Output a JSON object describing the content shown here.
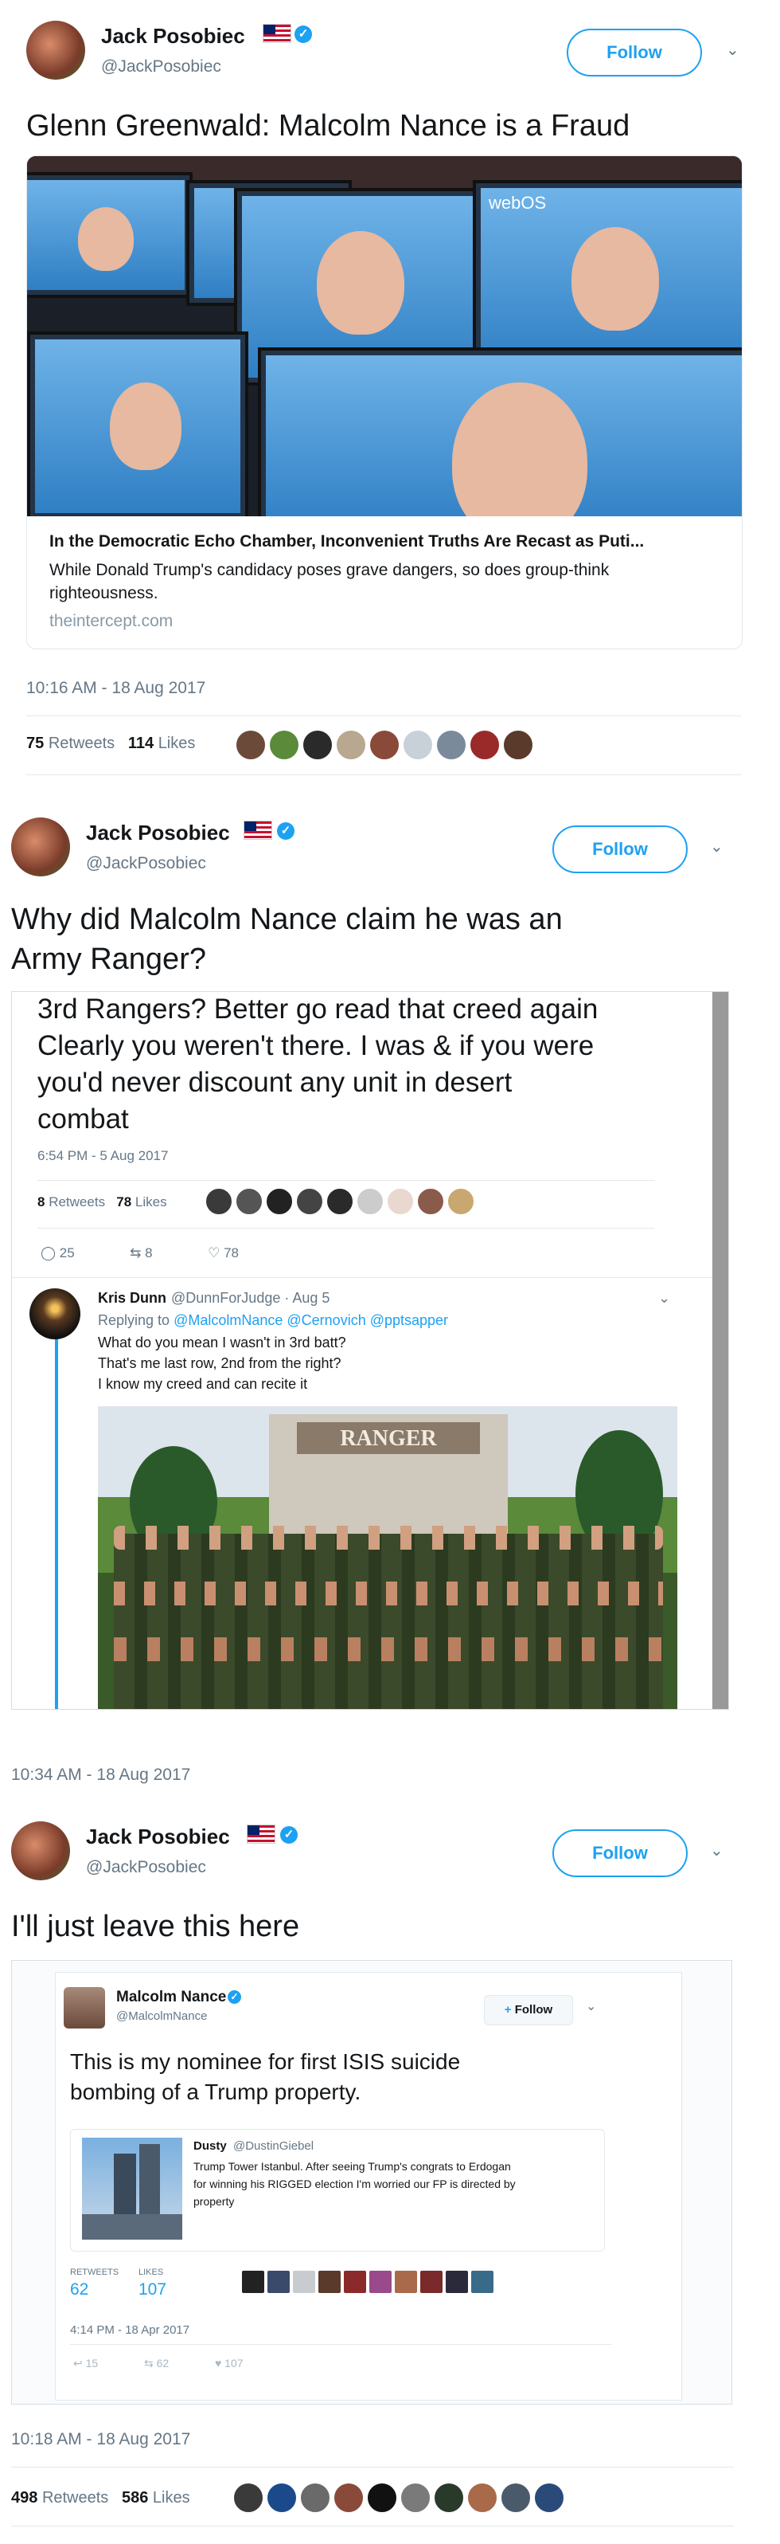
{
  "tweet1": {
    "name": "Jack Posobiec",
    "handle": "@JackPosobiec",
    "follow": "Follow",
    "text": "Glenn Greenwald: Malcolm Nance is a Fraud",
    "card": {
      "title": "In the Democratic Echo Chamber, Inconvenient Truths Are Recast as Puti...",
      "description": "While Donald Trump's candidacy poses grave dangers, so does group-think righteousness.",
      "domain": "theintercept.com",
      "tv_label": "webOS"
    },
    "timestamp": "10:16 AM - 18 Aug 2017",
    "retweets": "75",
    "retweets_label": "Retweets",
    "likes": "114",
    "likes_label": "Likes"
  },
  "tweet2": {
    "name": "Jack Posobiec",
    "handle": "@JackPosobiec",
    "follow": "Follow",
    "text_line1": "Why did Malcolm Nance claim he was an",
    "text_line2": "Army Ranger?",
    "embedded": {
      "line1": "3rd Rangers? Better go read that creed again",
      "line2": "Clearly you weren't there. I was & if you were",
      "line3": "you'd never discount any unit in desert",
      "line4": "combat",
      "timestamp": "6:54 PM - 5 Aug 2017",
      "retweets": "8",
      "retweets_label": "Retweets",
      "likes": "78",
      "likes_label": "Likes",
      "reply_count": "25",
      "rt_count": "8",
      "like_count": "78",
      "reply": {
        "name": "Kris Dunn",
        "handle": "@DunnForJudge · Aug 5",
        "replying_label": "Replying to",
        "replying_to": "@MalcolmNance @Cernovich @pptsapper",
        "line1": "What do you mean I wasn't in 3rd batt?",
        "line2": "That's me last row, 2nd from the right?",
        "line3": "I know my creed and can recite it",
        "sign": "RANGER"
      }
    },
    "timestamp": "10:34 AM - 18 Aug 2017"
  },
  "tweet3": {
    "name": "Jack Posobiec",
    "handle": "@JackPosobiec",
    "follow": "Follow",
    "text": "I'll just leave this here",
    "embedded": {
      "name": "Malcolm Nance",
      "handle": "@MalcolmNance",
      "follow": "Follow",
      "text_line1": "This is my nominee for first ISIS suicide",
      "text_line2": "bombing of a Trump property.",
      "quote": {
        "name": "Dusty",
        "handle": "@DustinGiebel",
        "line1": "Trump Tower Istanbul. After seeing Trump's congrats to Erdogan",
        "line2": "for winning his RIGGED election I'm worried our FP is directed by",
        "line3": "property"
      },
      "retweets_label": "RETWEETS",
      "retweets": "62",
      "likes_label": "LIKES",
      "likes": "107",
      "timestamp": "4:14 PM - 18 Apr 2017",
      "reply_count": "15",
      "rt_count": "62",
      "like_count": "107"
    },
    "timestamp": "10:18 AM - 18 Aug 2017",
    "retweets": "498",
    "retweets_label": "Retweets",
    "likes": "586",
    "likes_label": "Likes"
  },
  "colors": {
    "twitter_blue": "#1da1f2",
    "text_dark": "#14171a",
    "text_gray": "#657786",
    "border": "#e1e8ed"
  },
  "icons": [
    "verified-badge-icon",
    "us-flag-icon",
    "chevron-down-icon",
    "reply-icon",
    "retweet-icon",
    "heart-icon",
    "add-user-icon"
  ]
}
